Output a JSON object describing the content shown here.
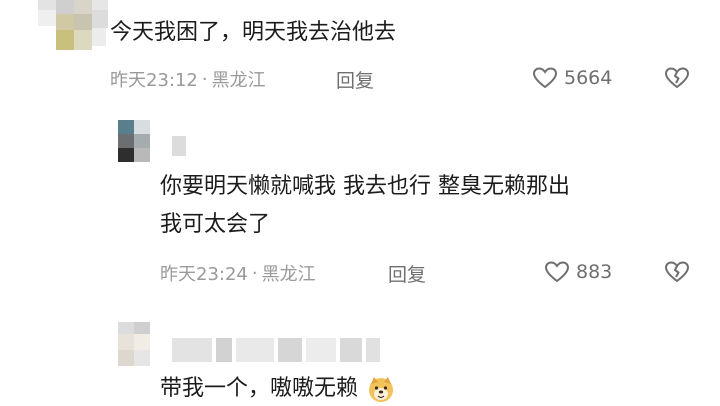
{
  "comments": [
    {
      "text": "今天我困了，明天我去治他去",
      "time": "昨天23:12",
      "location": "黑龙江",
      "reply_label": "回复",
      "likes": "5664"
    },
    {
      "text_line1": "你要明天懒就喊我  我去也行  整臭无赖那出",
      "text_line2": "我可太会了",
      "time": "昨天23:24",
      "location": "黑龙江",
      "reply_label": "回复",
      "likes": "883"
    },
    {
      "text": "带我一个，嗷嗷无赖"
    }
  ],
  "separator": "·",
  "icons": {
    "like": "heart-outline-icon",
    "dislike": "broken-heart-icon",
    "emoji": "doge-emoji-icon"
  },
  "colors": {
    "text": "#1c1c1c",
    "meta": "#9a9a9a",
    "icon": "#6f6f6f"
  }
}
